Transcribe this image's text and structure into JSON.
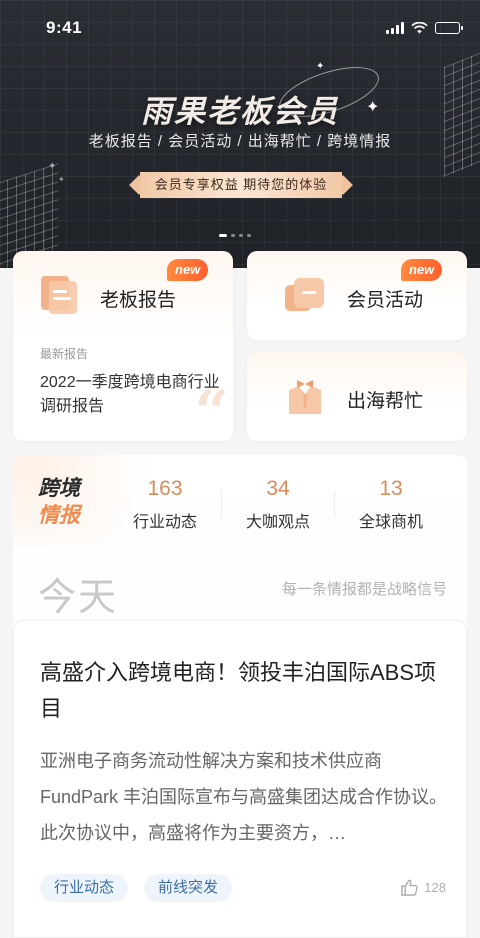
{
  "status_bar": {
    "time": "9:41"
  },
  "hero": {
    "title": "雨果老板会员",
    "subtitle": "老板报告 / 会员活动 / 出海帮忙 / 跨境情报",
    "ribbon": "会员专享权益 期待您的体验",
    "carousel": {
      "total": 4,
      "active": 0
    }
  },
  "cards": {
    "report": {
      "title": "老板报告",
      "badge": "new",
      "latest_label": "最新报告",
      "latest_title": "2022一季度跨境电商行业调研报告"
    },
    "activity": {
      "title": "会员活动",
      "badge": "new"
    },
    "help": {
      "title": "出海帮忙"
    }
  },
  "intel": {
    "logo_line1": "跨境",
    "logo_line2": "情报",
    "stats": [
      {
        "count": "163",
        "label": "行业动态"
      },
      {
        "count": "34",
        "label": "大咖观点"
      },
      {
        "count": "13",
        "label": "全球商机"
      }
    ]
  },
  "today": {
    "label": "今天",
    "slogan": "每一条情报都是战略信号"
  },
  "article": {
    "title": "高盛介入跨境电商！领投丰泊国际ABS项目",
    "summary": "亚洲电子商务流动性解决方案和技术供应商FundPark 丰泊国际宣布与高盛集团达成合作协议。此次协议中，高盛将作为主要资方，…",
    "tags": [
      "行业动态",
      "前线突发"
    ],
    "likes": "128"
  },
  "colors": {
    "accent": "#ee8d52",
    "number": "#d98b59",
    "tag_text": "#3d6ea5",
    "tag_bg": "#eef4fb",
    "badge": "#ff6a32",
    "hero_bg": "#24272c"
  }
}
